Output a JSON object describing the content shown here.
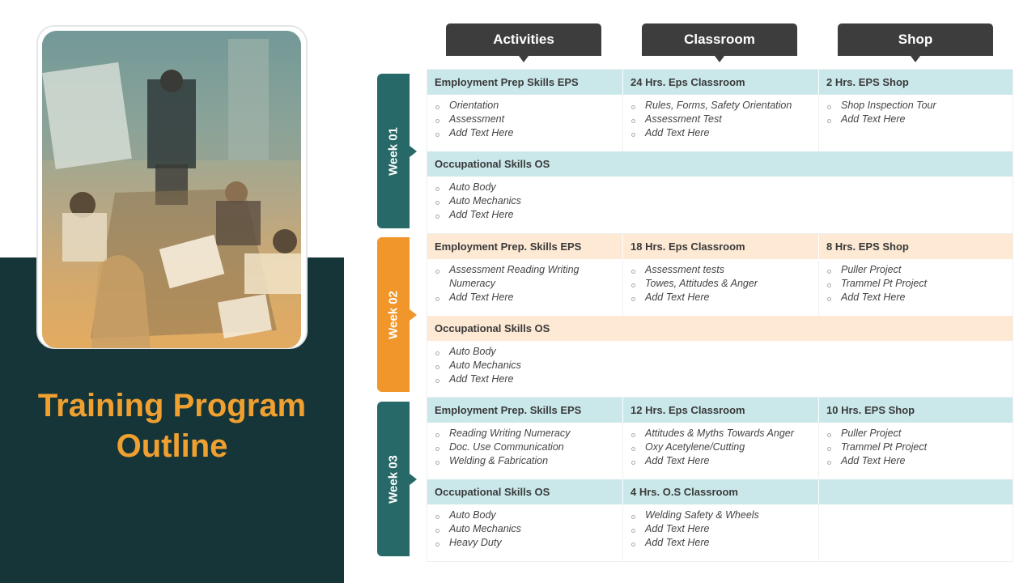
{
  "title": "Training Program Outline",
  "photo": {
    "alt": "team-meeting-photo",
    "description": "Presenter at whiteboard with team around a table"
  },
  "columns": [
    "Activities",
    "Classroom",
    "Shop"
  ],
  "colors": {
    "teal": "#276868",
    "orange": "#f0962a",
    "dark_panel": "#163538",
    "title": "#f0a030",
    "header_dark": "#3d3d3d",
    "row_teal": "#cae8ea",
    "row_orange": "#fde9d4"
  },
  "weeks": [
    {
      "label": "Week 01",
      "eps": {
        "activity_title": "Employment Prep Skills EPS",
        "activity_items": [
          "Orientation",
          "Assessment",
          "Add Text Here"
        ],
        "classroom_title": "24 Hrs. Eps Classroom",
        "classroom_items": [
          "Rules, Forms, Safety Orientation",
          "Assessment Test",
          "Add Text Here"
        ],
        "shop_title": "2 Hrs. EPS Shop",
        "shop_items": [
          "Shop Inspection Tour",
          "Add Text Here"
        ]
      },
      "os": {
        "activity_title": "Occupational Skills OS",
        "activity_items": [
          "Auto Body",
          "Auto Mechanics",
          "Add Text Here"
        ]
      }
    },
    {
      "label": "Week 02",
      "eps": {
        "activity_title": "Employment Prep. Skills EPS",
        "activity_items": [
          "Assessment Reading Writing Numeracy",
          "Add Text Here"
        ],
        "classroom_title": "18 Hrs. Eps Classroom",
        "classroom_items": [
          "Assessment tests",
          "Towes, Attitudes & Anger",
          "Add Text Here"
        ],
        "shop_title": "8 Hrs. EPS Shop",
        "shop_items": [
          "Puller Project",
          "Trammel Pt Project",
          "Add Text Here"
        ]
      },
      "os": {
        "activity_title": "Occupational Skills OS",
        "activity_items": [
          "Auto Body",
          "Auto Mechanics",
          "Add Text Here"
        ]
      }
    },
    {
      "label": "Week 03",
      "eps": {
        "activity_title": "Employment Prep. Skills EPS",
        "activity_items": [
          "Reading Writing Numeracy",
          "Doc. Use Communication",
          "Welding & Fabrication"
        ],
        "classroom_title": "12 Hrs. Eps Classroom",
        "classroom_items": [
          "Attitudes & Myths Towards Anger",
          "Oxy Acetylene/Cutting",
          "Add Text Here"
        ],
        "shop_title": "10 Hrs. EPS Shop",
        "shop_items": [
          "Puller Project",
          "Trammel Pt Project",
          "Add Text Here"
        ]
      },
      "os": {
        "activity_title": "Occupational Skills OS",
        "activity_items": [
          "Auto Body",
          "Auto Mechanics",
          "Heavy Duty"
        ],
        "classroom_title": "4 Hrs. O.S Classroom",
        "classroom_items": [
          "Welding Safety & Wheels",
          "Add Text Here",
          "Add Text Here"
        ],
        "shop_title": "",
        "shop_items": []
      }
    }
  ]
}
